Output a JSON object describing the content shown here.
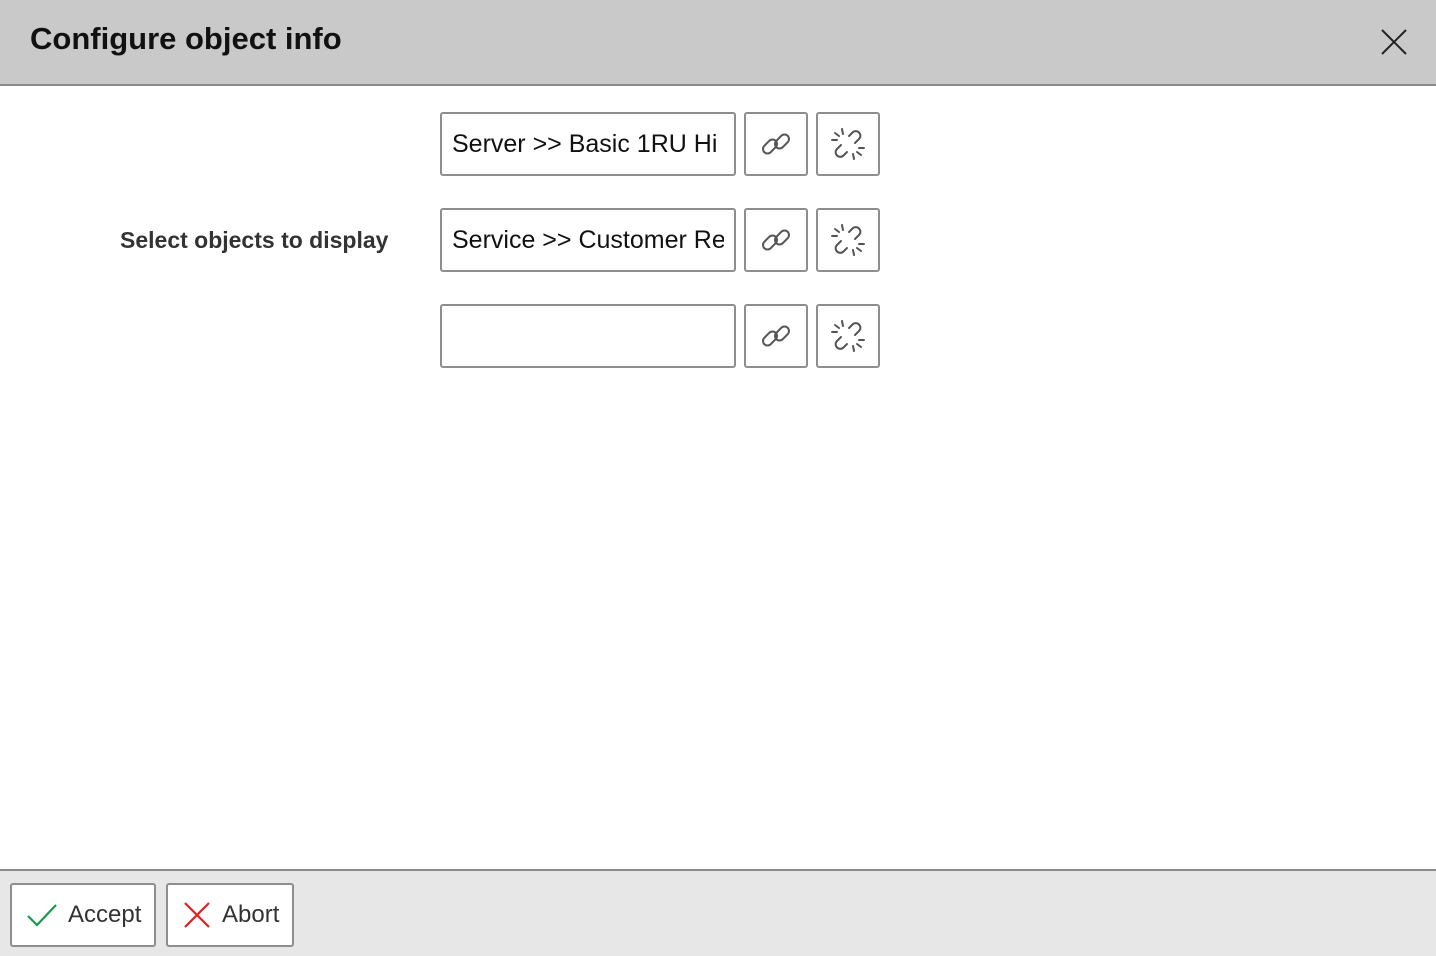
{
  "dialog": {
    "title": "Configure object info",
    "close_icon": "close-icon"
  },
  "form": {
    "label": "Select objects to display",
    "rows": [
      {
        "value": "Server >> Basic 1RU Hi",
        "link_icon": "link-icon",
        "unlink_icon": "unlink-icon"
      },
      {
        "value": "Service >> Customer Re",
        "link_icon": "link-icon",
        "unlink_icon": "unlink-icon"
      },
      {
        "value": "",
        "link_icon": "link-icon",
        "unlink_icon": "unlink-icon"
      }
    ]
  },
  "footer": {
    "accept_label": "Accept",
    "abort_label": "Abort",
    "accept_icon": "check-icon",
    "abort_icon": "x-icon",
    "accept_color": "#1a9a4a",
    "abort_color": "#e02020"
  }
}
